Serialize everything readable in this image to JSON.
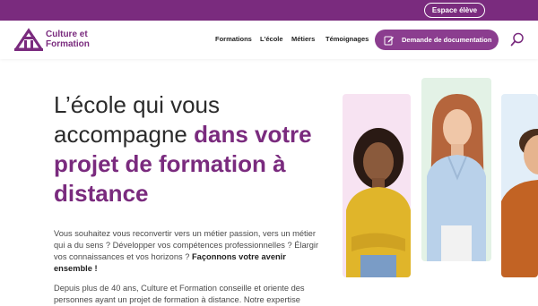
{
  "topbar": {
    "espace_label": "Espace élève",
    "bg": "#7a2b7e"
  },
  "brand": {
    "line1": "Culture et",
    "line2": "Formation",
    "color": "#7a2b7e"
  },
  "nav": {
    "items": [
      "Formations",
      "L'école",
      "Métiers",
      "Témoignages"
    ]
  },
  "cta": {
    "doc_label": "Demande de documentation",
    "color": "#8b3d8f"
  },
  "hero": {
    "title_plain_1": "L’école qui vous",
    "title_plain_2": "accompagne ",
    "title_accent_1": "dans votre",
    "title_accent_2": "projet de formation à",
    "title_accent_3": "distance",
    "para1_plain": "Vous souhaitez vous reconvertir vers un métier passion, vers un métier qui a du sens ? Développer vos compétences professionnelles ? Élargir vos connaissances et vos horizons ? ",
    "para1_bold": "Façonnons votre avenir ensemble !",
    "para2": "Depuis plus de 40 ans, Culture et Formation conseille et oriente des personnes ayant un projet de formation à distance. Notre expertise"
  },
  "cards": {
    "bg_pink": "#f7e3f2",
    "bg_green": "#e3f2e6",
    "bg_blue": "#e2eef8"
  }
}
